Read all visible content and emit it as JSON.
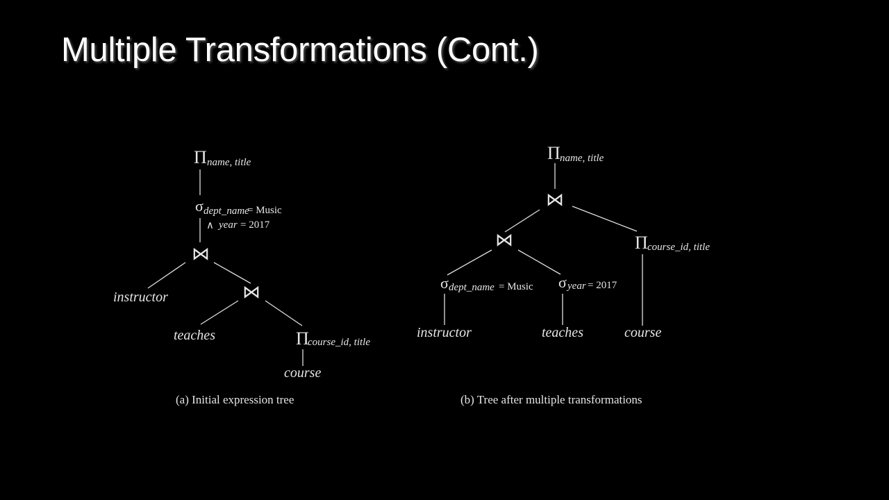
{
  "slide": {
    "title": "Multiple Transformations (Cont.)"
  },
  "symbols": {
    "project": "Π",
    "select": "σ",
    "join": "⋈",
    "and": "∧"
  },
  "tree_a": {
    "caption": "(a) Initial expression tree",
    "root_project_attrs": "name, title",
    "select_attr1": "dept_name",
    "select_rest1": " = Music",
    "select_attr2": "year",
    "select_rest2": " = 2017",
    "leaf_instructor": "instructor",
    "leaf_teaches": "teaches",
    "inner_project_attrs": "course_id, title",
    "leaf_course": "course"
  },
  "tree_b": {
    "caption": "(b) Tree after multiple transformations",
    "root_project_attrs": "name, title",
    "inner_project_attrs": "course_id, title",
    "select1_attr": "dept_name",
    "select1_rest": " = Music",
    "select2_attr": "year",
    "select2_rest": " = 2017",
    "leaf_instructor": "instructor",
    "leaf_teaches": "teaches",
    "leaf_course": "course"
  }
}
